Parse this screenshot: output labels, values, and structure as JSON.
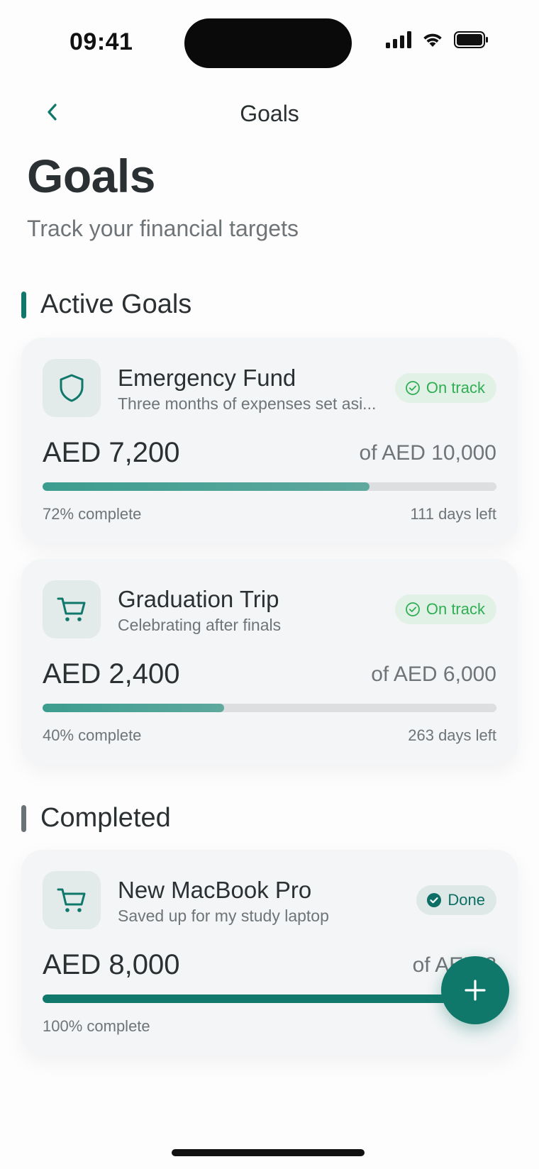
{
  "status_bar": {
    "time": "09:41",
    "icons": [
      "cellular-signal-icon",
      "wifi-icon",
      "battery-icon"
    ]
  },
  "nav": {
    "title": "Goals",
    "back_icon": "chevron-left-icon"
  },
  "header": {
    "title": "Goals",
    "subtitle": "Track your financial targets"
  },
  "colors": {
    "accent": "#10786b",
    "on_track": "#2fae54",
    "completed_bar": "#6b7275"
  },
  "sections": [
    {
      "title": "Active Goals",
      "goals": [
        {
          "icon": "shield-icon",
          "title": "Emergency Fund",
          "description": "Three months of expenses set asi...",
          "status": "On track",
          "status_icon": "check-circle-icon",
          "amount": "AED 7,200",
          "target": "of AED 10,000",
          "progress": 0.72,
          "percent_label": "72% complete",
          "days_left": "111 days left"
        },
        {
          "icon": "cart-icon",
          "title": "Graduation Trip",
          "description": "Celebrating after finals",
          "status": "On track",
          "status_icon": "check-circle-icon",
          "amount": "AED 2,400",
          "target": "of AED 6,000",
          "progress": 0.4,
          "percent_label": "40% complete",
          "days_left": "263 days left"
        }
      ]
    },
    {
      "title": "Completed",
      "goals": [
        {
          "icon": "cart-icon",
          "title": "New MacBook Pro",
          "description": "Saved up for my study laptop",
          "status": "Done",
          "status_icon": "check-circle-filled-icon",
          "amount": "AED 8,000",
          "target": "of AED 8",
          "progress": 1.0,
          "percent_label": "100% complete"
        }
      ]
    }
  ],
  "fab": {
    "icon": "plus-icon"
  }
}
